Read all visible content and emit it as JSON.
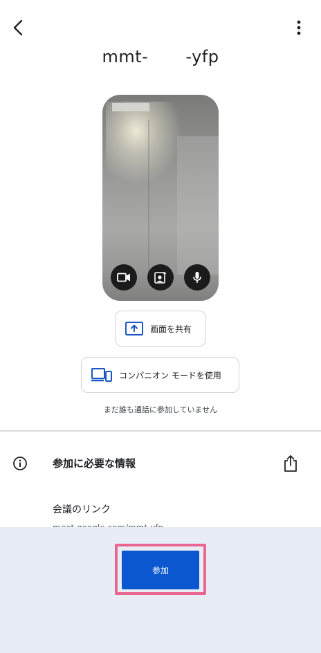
{
  "header": {
    "back_icon": "arrow-back-icon",
    "more_icon": "more-vert-icon",
    "meeting_code_prefix": "mmt-",
    "meeting_code_suffix": "-yfp"
  },
  "preview": {
    "controls": [
      {
        "name": "camera-toggle",
        "icon": "videocam-icon"
      },
      {
        "name": "effects",
        "icon": "portrait-sparkle-icon"
      },
      {
        "name": "mic-toggle",
        "icon": "mic-icon"
      }
    ]
  },
  "actions": {
    "share_screen_label": "画面を共有",
    "share_screen_icon": "present-to-all-icon",
    "companion_label": "コンパニオン モードを使用",
    "companion_icon": "devices-icon"
  },
  "status": {
    "text": "まだ誰も通話に参加していません"
  },
  "info": {
    "icon": "info-icon",
    "title": "参加に必要な情報",
    "share_icon": "share-icon",
    "link_label": "会議のリンク",
    "link_url": "meet.google.com/mmt-yfp"
  },
  "join": {
    "label": "参加",
    "button_color": "#0b57d0",
    "highlight_color": "#e8668f"
  }
}
